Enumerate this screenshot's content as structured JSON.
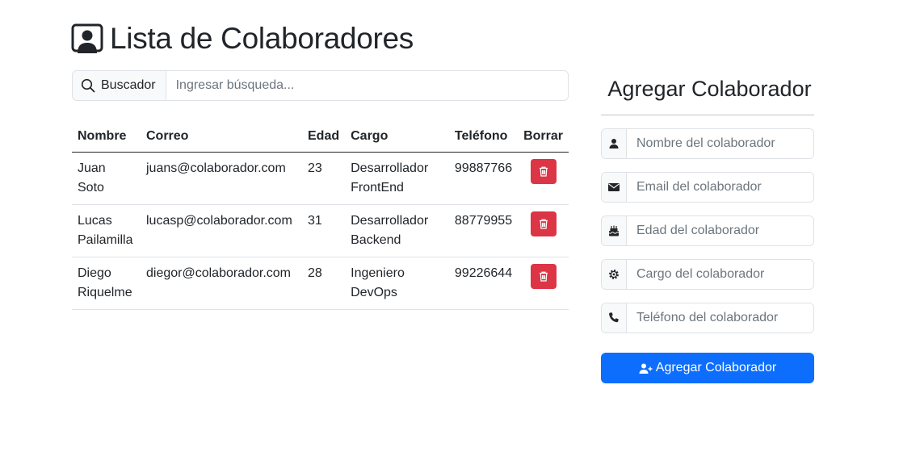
{
  "page": {
    "title": "Lista de Colaboradores"
  },
  "search": {
    "label": "Buscador",
    "placeholder": "Ingresar búsqueda..."
  },
  "table": {
    "headers": [
      "Nombre",
      "Correo",
      "Edad",
      "Cargo",
      "Teléfono",
      "Borrar"
    ],
    "rows": [
      {
        "name": "Juan Soto",
        "email": "juans@colaborador.com",
        "age": "23",
        "role": "Desarrollador FrontEnd",
        "phone": "99887766"
      },
      {
        "name": "Lucas Pailamilla",
        "email": "lucasp@colaborador.com",
        "age": "31",
        "role": "Desarrollador Backend",
        "phone": "88779955"
      },
      {
        "name": "Diego Riquelme",
        "email": "diegor@colaborador.com",
        "age": "28",
        "role": "Ingeniero DevOps",
        "phone": "99226644"
      }
    ]
  },
  "form": {
    "title": "Agregar Colaborador",
    "fields": [
      {
        "icon": "person-icon",
        "placeholder": "Nombre del colaborador"
      },
      {
        "icon": "envelope-icon",
        "placeholder": "Email del colaborador"
      },
      {
        "icon": "cake-icon",
        "placeholder": "Edad del colaborador"
      },
      {
        "icon": "gear-icon",
        "placeholder": "Cargo del colaborador"
      },
      {
        "icon": "phone-icon",
        "placeholder": "Teléfono del colaborador"
      }
    ],
    "submit_label": "Agregar Colaborador"
  },
  "colors": {
    "primary": "#0d6efd",
    "danger": "#dc3545",
    "text": "#212529"
  }
}
